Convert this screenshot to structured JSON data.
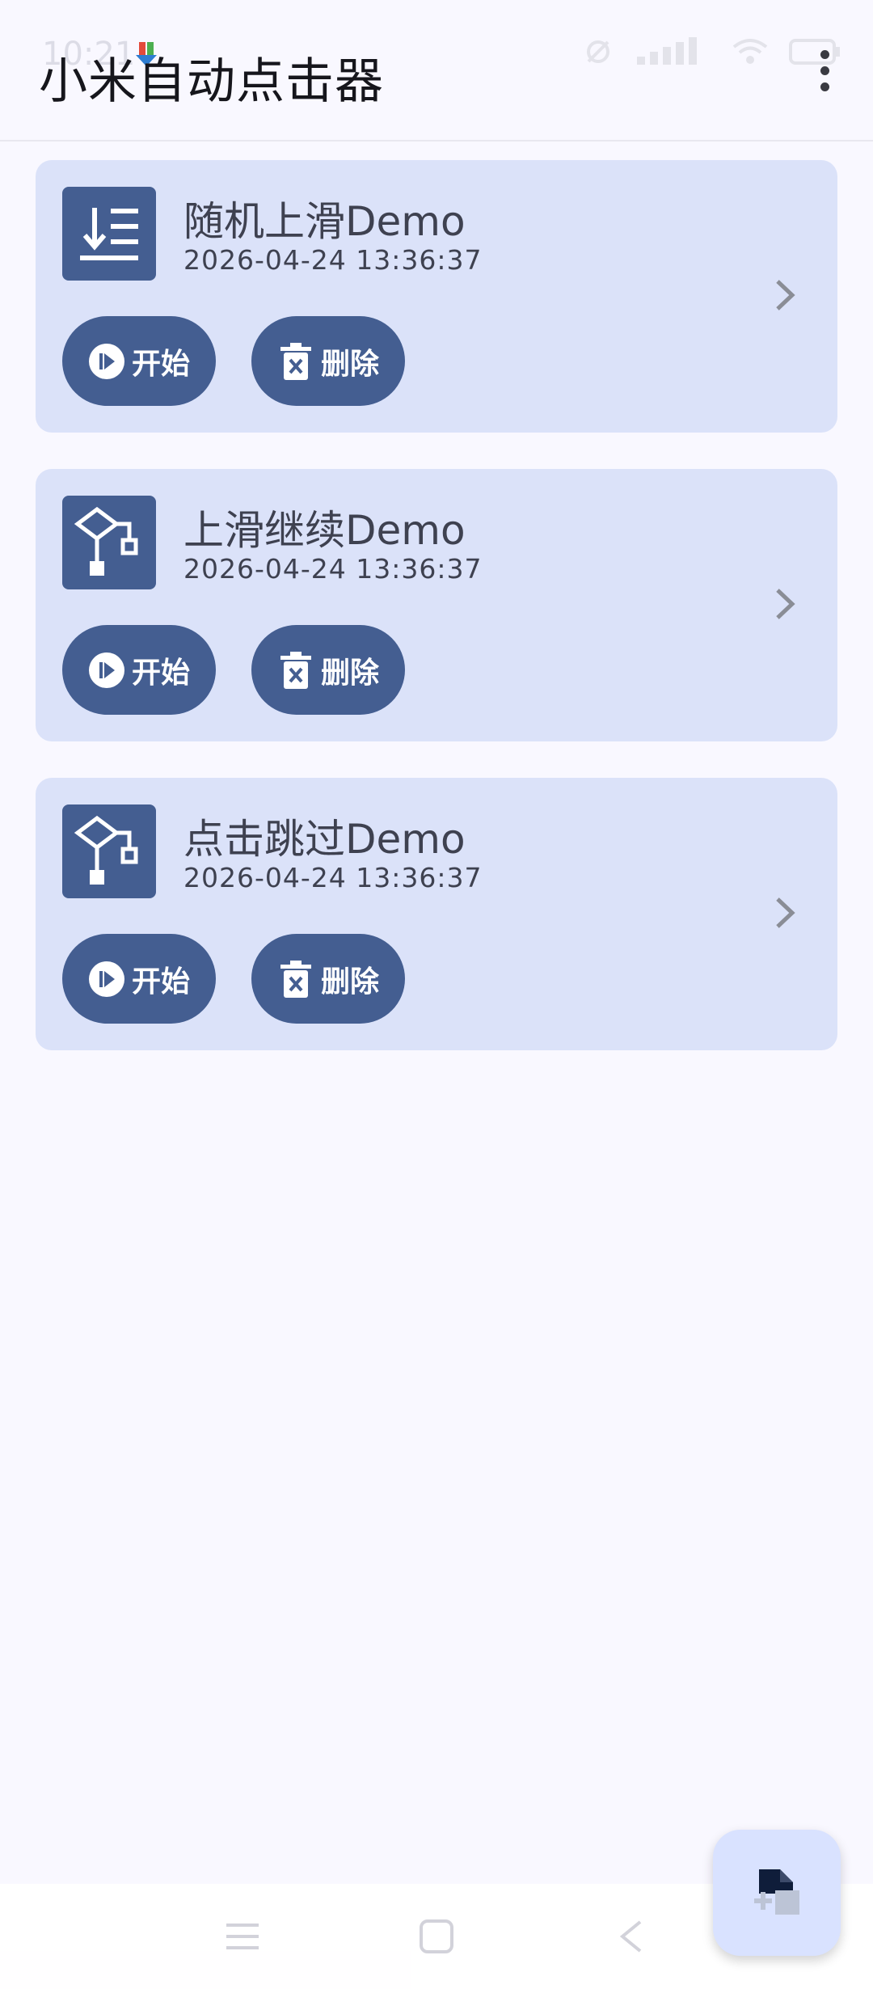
{
  "status_bar": {
    "time": "10:21"
  },
  "app_bar": {
    "title": "小米自动点击器"
  },
  "cards": [
    {
      "title": "随机上滑Demo",
      "timestamp": "2026-04-24 13:36:37",
      "icon": "list-sort-icon",
      "start_label": "开始",
      "delete_label": "删除"
    },
    {
      "title": "上滑继续Demo",
      "timestamp": "2026-04-24 13:36:37",
      "icon": "flowchart-icon",
      "start_label": "开始",
      "delete_label": "删除"
    },
    {
      "title": "点击跳过Demo",
      "timestamp": "2026-04-24 13:36:37",
      "icon": "flowchart-icon",
      "start_label": "开始",
      "delete_label": "删除"
    }
  ],
  "fab": {
    "icon": "add-file-icon"
  },
  "colors": {
    "background": "#f9f8ff",
    "card": "#dbe2f9",
    "accent": "#445e91"
  }
}
